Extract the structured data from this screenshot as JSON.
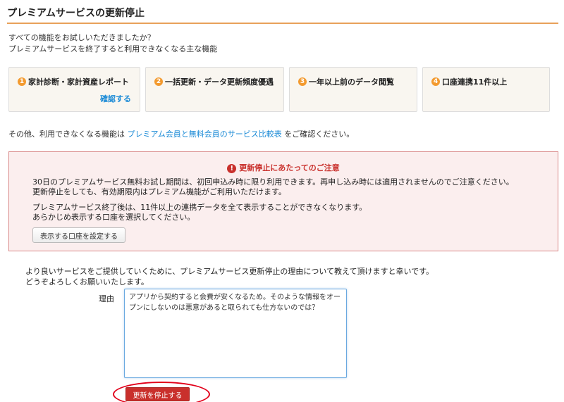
{
  "page": {
    "title": "プレミアムサービスの更新停止",
    "intro_line1": "すべての機能をお試しいただきましたか？",
    "intro_line2": "プレミアムサービスを終了すると利用できなくなる主な機能"
  },
  "features": [
    {
      "num": "1",
      "label": "家計診断・家計資産レポート",
      "link": "確認する"
    },
    {
      "num": "2",
      "label": "一括更新・データ更新頻度優遇"
    },
    {
      "num": "3",
      "label": "一年以上前のデータ閲覧"
    },
    {
      "num": "4",
      "label": "口座連携11件以上"
    }
  ],
  "compare": {
    "prefix": "その他、利用できなくなる機能は",
    "link": "プレミアム会員と無料会員のサービス比較表",
    "suffix": "をご確認ください。"
  },
  "warning": {
    "icon": "!",
    "title": "更新停止にあたってのご注意",
    "p1_line1": "30日のプレミアムサービス無料お試し期間は、初回申込み時に限り利用できます。再申し込み時には適用されませんのでご注意ください。",
    "p1_line2": "更新停止をしても、有効期限内はプレミアム機能がご利用いただけます。",
    "p2_line1": "プレミアムサービス終了後は、11件以上の連携データを全て表示することができなくなります。",
    "p2_line2": "あらかじめ表示する口座を選択してください。",
    "button": "表示する口座を設定する"
  },
  "reason": {
    "intro_line1": "より良いサービスをご提供していくために、プレミアムサービス更新停止の理由について教えて頂けますと幸いです。",
    "intro_line2": "どうぞよろしくお願いいたします。",
    "label": "理由",
    "value": "アプリから契約すると会費が安くなるため。そのような情報をオープンにしないのは悪意があると取られても仕方ないのでは？"
  },
  "submit": {
    "label": "更新を停止する"
  },
  "colors": {
    "accent_orange": "#f39a2f",
    "link_blue": "#1a8ad6",
    "warning_red": "#c9302c",
    "highlight_red": "#e2001a"
  }
}
